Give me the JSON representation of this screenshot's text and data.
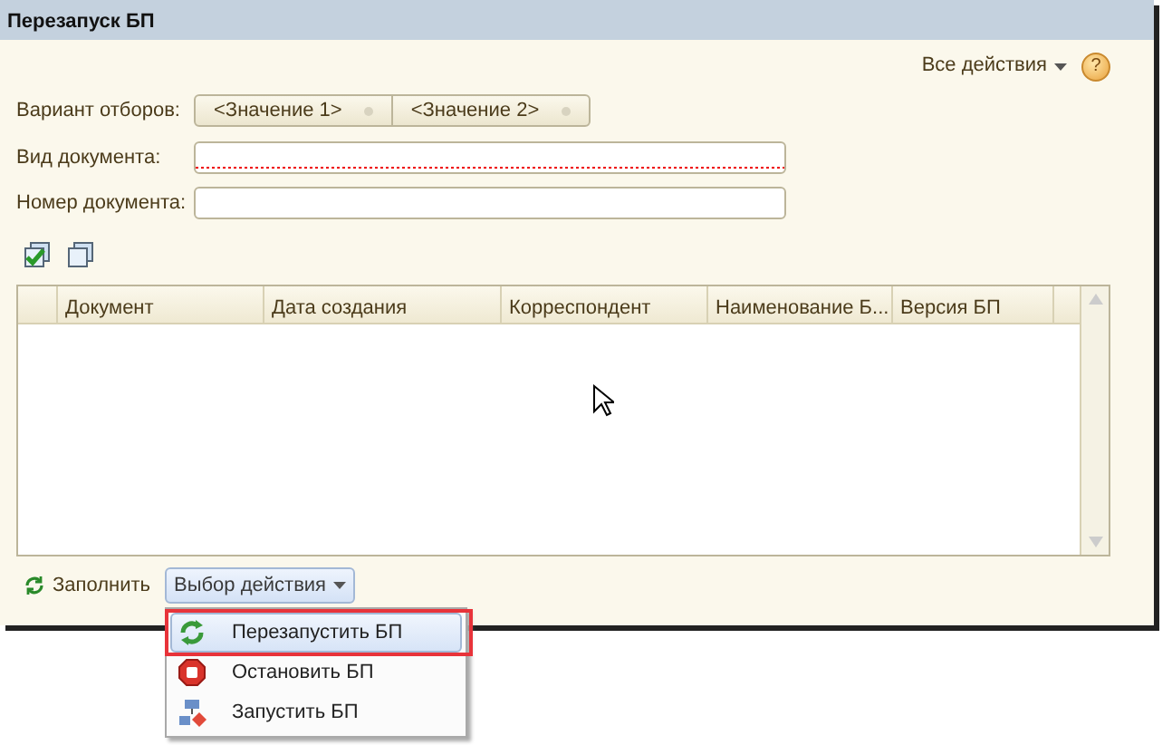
{
  "window": {
    "title": "Перезапуск БП"
  },
  "header_actions": {
    "all_actions": "Все действия",
    "help": "?"
  },
  "filters": {
    "label": "Вариант отборов:",
    "options": [
      {
        "label": "<Значение 1>",
        "selected": false
      },
      {
        "label": "<Значение 2>",
        "selected": false
      }
    ]
  },
  "fields": [
    {
      "label": "Вид документа:",
      "required": true
    },
    {
      "label": "Номер документа:",
      "required": false
    }
  ],
  "table": {
    "columns": [
      "",
      "Документ",
      "Дата создания",
      "Корреспондент",
      "Наименование Б...",
      "Версия БП"
    ]
  },
  "footer": {
    "fill_button": "Заполнить",
    "action_button": "Выбор действия"
  },
  "action_menu": [
    {
      "kind": "restart",
      "label": "Перезапустить БП",
      "selected": true
    },
    {
      "kind": "stop",
      "label": "Остановить БП",
      "selected": false
    },
    {
      "kind": "start",
      "label": "Запустить БП",
      "selected": false
    }
  ]
}
